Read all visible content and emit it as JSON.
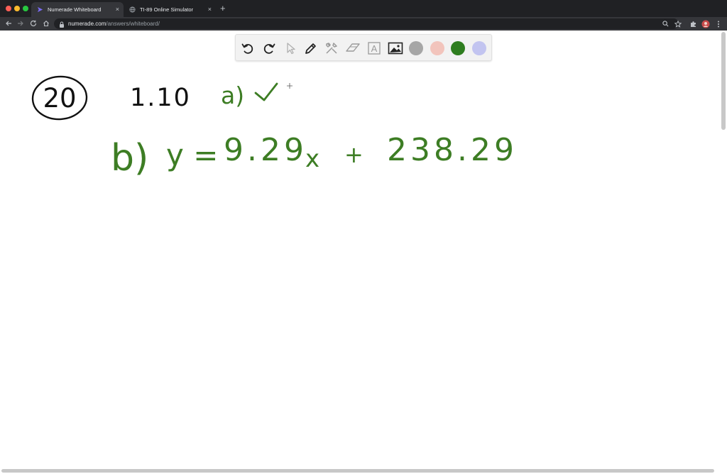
{
  "browser": {
    "tabs": [
      {
        "title": "Numerade Whiteboard",
        "active": true,
        "icon": "numerade-logo-icon"
      },
      {
        "title": "TI-89 Online Simulator",
        "active": false,
        "icon": "globe-icon"
      }
    ],
    "close_glyph": "×",
    "newtab_glyph": "+",
    "url_host": "numerade.com",
    "url_path": "/answers/whiteboard/"
  },
  "whiteboard": {
    "tools": [
      "undo-icon",
      "redo-icon",
      "pointer-icon",
      "pen-icon",
      "tools-icon",
      "eraser-icon",
      "text-icon",
      "image-icon"
    ],
    "text_tool_glyph": "A",
    "colors": [
      "#a6a6a6",
      "#f2c4bc",
      "#2e7d1f",
      "#c2c4f0"
    ]
  },
  "handwriting": {
    "problem_number": "20",
    "value": "1.10",
    "part_a_label": "a)",
    "part_a_mark": "✓",
    "part_b_label": "b)",
    "equation_lhs": "y =",
    "slope": "9.29",
    "variable": "x",
    "plus": "+",
    "intercept": "238.29",
    "ink_black": "#111111",
    "ink_green": "#3d7d24"
  }
}
